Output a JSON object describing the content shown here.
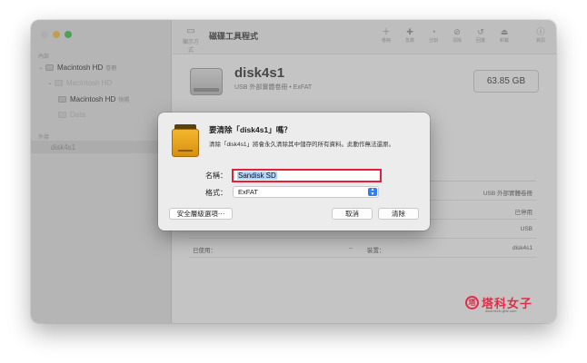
{
  "window": {
    "title": "磁碟工具程式"
  },
  "sidebar": {
    "section_internal": "內部",
    "section_external": "外接",
    "items": [
      {
        "label": "Macintosh HD",
        "tag": "卷冊"
      },
      {
        "label": "Macintosh HD"
      },
      {
        "label": "Macintosh HD",
        "tag": "快照"
      },
      {
        "label": "Data"
      },
      {
        "label": "disk4s1"
      }
    ]
  },
  "toolbar": {
    "view_label": "顯示方式",
    "buttons": [
      {
        "icon": "add-remove-icon",
        "label": "卷冊"
      },
      {
        "icon": "first-aid-icon",
        "label": "急救"
      },
      {
        "icon": "partition-icon",
        "label": "分割"
      },
      {
        "icon": "erase-icon",
        "label": "清除"
      },
      {
        "icon": "restore-icon",
        "label": "回復"
      },
      {
        "icon": "unmount-icon",
        "label": "卸載"
      },
      {
        "icon": "info-icon",
        "label": "資訊"
      }
    ]
  },
  "disk": {
    "name": "disk4s1",
    "subtitle": "USB 外部實體卷冊 • ExFAT",
    "size": "63.85 GB"
  },
  "info_rows": [
    {
      "right_value": "USB 外部實體卷冊"
    },
    {
      "right_value": "已停用"
    },
    {
      "right_value": "USB"
    },
    {
      "left_label": "已使用：",
      "left_value": "--",
      "right_label": "裝置：",
      "right_value": "disk4s1"
    }
  ],
  "dialog": {
    "title": "要清除「disk4s1」嗎？",
    "message": "清除「disk4s1」將會永久清除其中儲存的所有資料。此動作無法還原。",
    "name_label": "名稱：",
    "name_value": "Sandisk SD",
    "format_label": "格式：",
    "format_value": "ExFAT",
    "security_button": "安全層級選項⋯",
    "cancel_button": "取消",
    "erase_button": "清除"
  },
  "watermark": {
    "mark": "塔",
    "text": "塔科女子",
    "url": "www.tech-girlz.com"
  },
  "colors": {
    "highlight_box": "#e2203e",
    "accent": "#2e7cf6",
    "drive_icon": "#f3b72e"
  }
}
